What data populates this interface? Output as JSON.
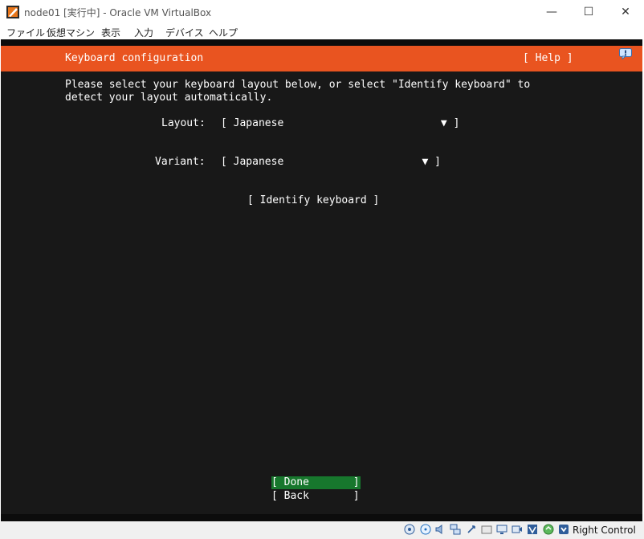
{
  "window": {
    "title": "node01 [実行中] - Oracle VM VirtualBox",
    "min_glyph": "—",
    "max_glyph": "☐",
    "close_glyph": "✕"
  },
  "menu": {
    "items": [
      "ファイル",
      "仮想マシン",
      "表示",
      "入力",
      "デバイス",
      "ヘルプ"
    ]
  },
  "installer": {
    "header_title": "Keyboard configuration",
    "help_label": "[ Help ]",
    "intro_line1": "Please select your keyboard layout below, or select \"Identify keyboard\" to",
    "intro_line2": "detect your layout automatically.",
    "layout_label": "Layout:",
    "layout_value": "[ Japanese                         ▼ ]",
    "variant_label": "Variant:",
    "variant_value": "[ Japanese                      ▼ ]",
    "identify_label": "[ Identify keyboard ]",
    "done_label": "[ Done       ]",
    "back_label": "[ Back       ]"
  },
  "statusbar": {
    "icons": [
      "hdd-icon",
      "optical-disc-icon",
      "audio-icon",
      "network-icon",
      "usb-icon",
      "shared-folders-icon",
      "display-icon",
      "video-capture-icon",
      "virtualization-icon",
      "mouse-integration-icon",
      "host-key-icon"
    ],
    "host_key": "Right Control"
  },
  "colors": {
    "accent": "#e95420",
    "done_bg": "#17772d",
    "screen_bg": "#181818"
  }
}
